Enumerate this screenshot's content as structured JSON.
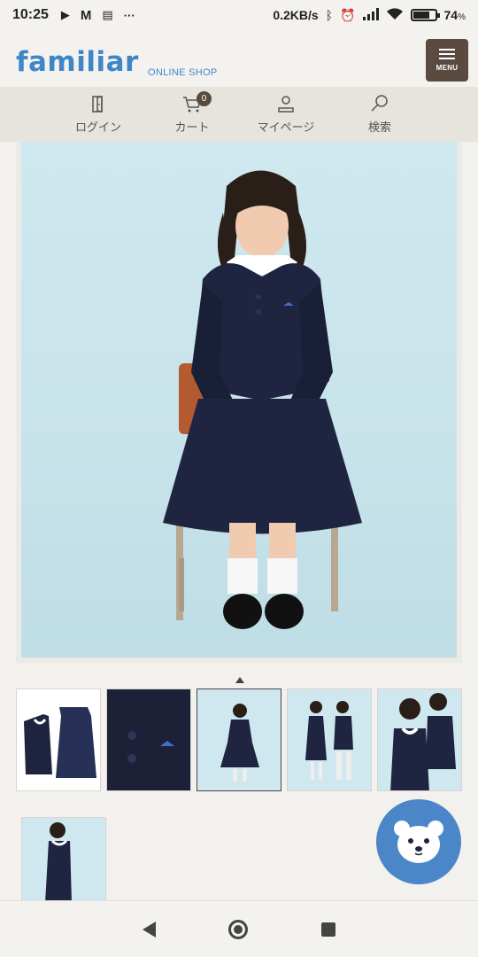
{
  "status_bar": {
    "time": "10:25",
    "net_speed": "0.2KB/s",
    "battery_percent": "74",
    "battery_unit": "%",
    "battery_level": 0.74,
    "icons": [
      "play-icon",
      "gmail-icon",
      "news-icon",
      "more-dots-icon",
      "bluetooth-icon",
      "alarm-icon",
      "signal-icon",
      "wifi-icon",
      "battery-icon"
    ]
  },
  "header": {
    "logo": "familiar",
    "logo_sub": "ONLINE SHOP",
    "menu_label": "MENU"
  },
  "nav": {
    "login": "ログイン",
    "cart": "カート",
    "cart_count": "0",
    "mypage": "マイページ",
    "search": "検索"
  },
  "product": {
    "thumbnail_count": 6,
    "selected_thumbnail": 3
  },
  "colors": {
    "brand_blue": "#3f86c9",
    "menu_brown": "#5a4a40",
    "navy": "#1f2440"
  }
}
